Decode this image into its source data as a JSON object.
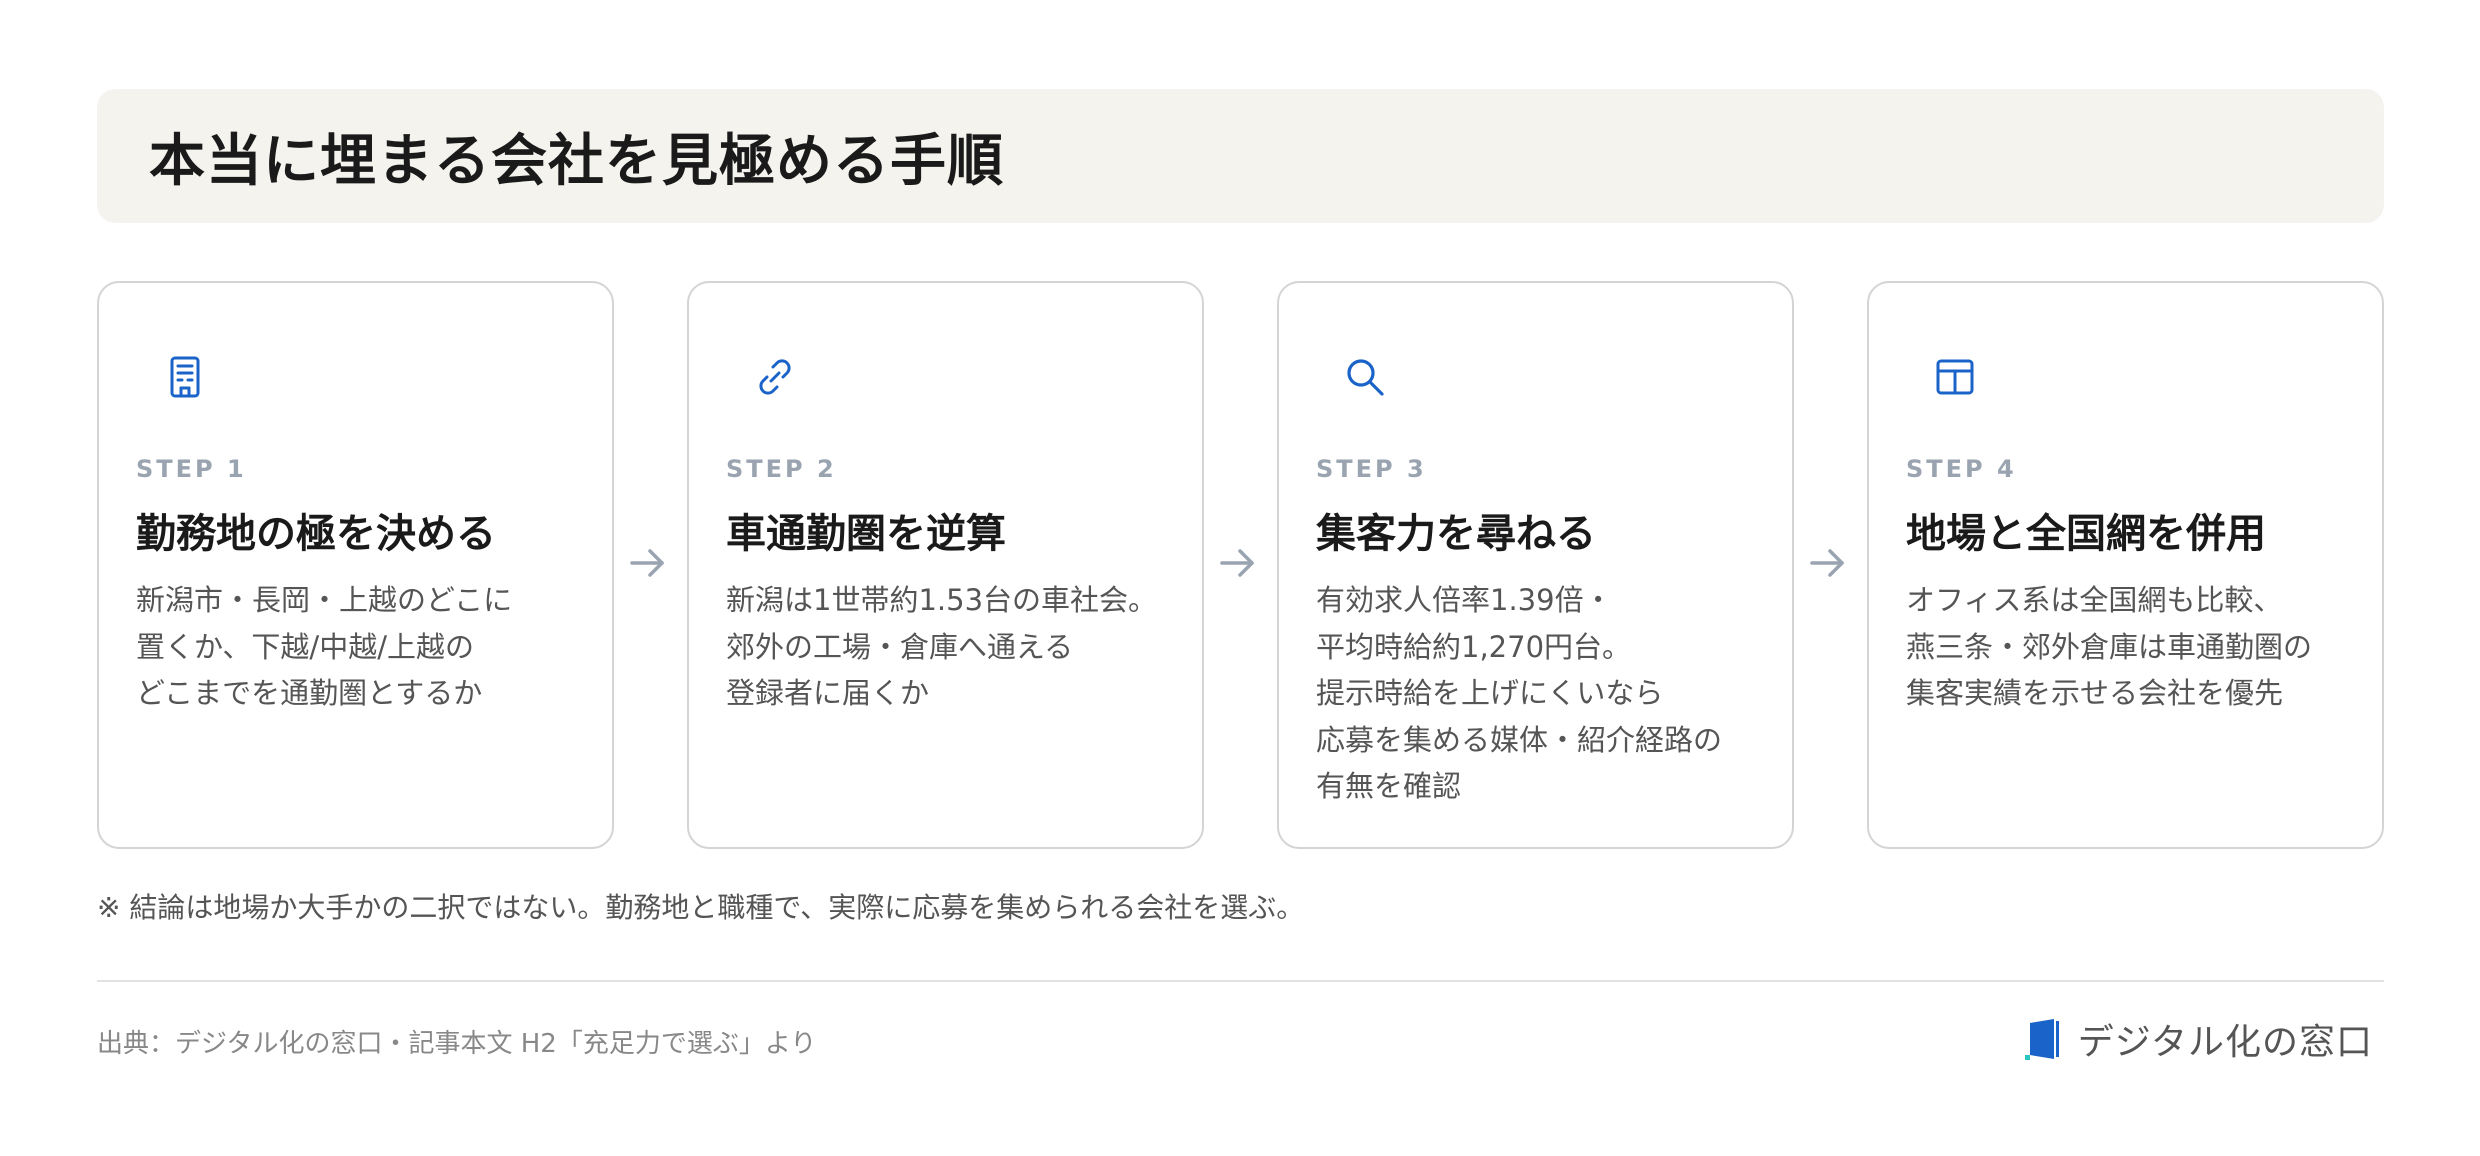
{
  "title": "本当に埋まる会社を見極める手順",
  "colors": {
    "icon_blue": "#1a63c8",
    "arrow_gray": "#9aa3b0",
    "title_band_bg": "#f5f3ee"
  },
  "steps": [
    {
      "label": "STEP 1",
      "title": "勤務地の極を決める",
      "icon": "building-icon",
      "body": [
        "新潟市・長岡・上越のどこに",
        "置くか、下越/中越/上越の",
        "どこまでを通勤圏とするか"
      ]
    },
    {
      "label": "STEP 2",
      "title": "車通勤圏を逆算",
      "icon": "link-icon",
      "body": [
        "新潟は1世帯約1.53台の車社会。",
        "郊外の工場・倉庫へ通える",
        "登録者に届くか"
      ]
    },
    {
      "label": "STEP 3",
      "title": "集客力を尋ねる",
      "icon": "search-icon",
      "body": [
        "有効求人倍率1.39倍・",
        "平均時給約1,270円台。",
        "提示時給を上げにくいなら",
        "応募を集める媒体・紹介経路の",
        "有無を確認"
      ]
    },
    {
      "label": "STEP 4",
      "title": "地場と全国網を併用",
      "icon": "table-grid-icon",
      "body": [
        "オフィス系は全国網も比較、",
        "燕三条・郊外倉庫は車通勤圏の",
        "集客実績を示せる会社を優先"
      ]
    }
  ],
  "note": "※ 結論は地場か大手かの二択ではない。勤務地と職種で、実際に応募を集められる会社を選ぶ。",
  "source": "出典：デジタル化の窓口・記事本文 H2「充足力で選ぶ」より",
  "brand": {
    "name": "デジタル化の窓口",
    "logo_icon": "brand-logo-icon"
  }
}
